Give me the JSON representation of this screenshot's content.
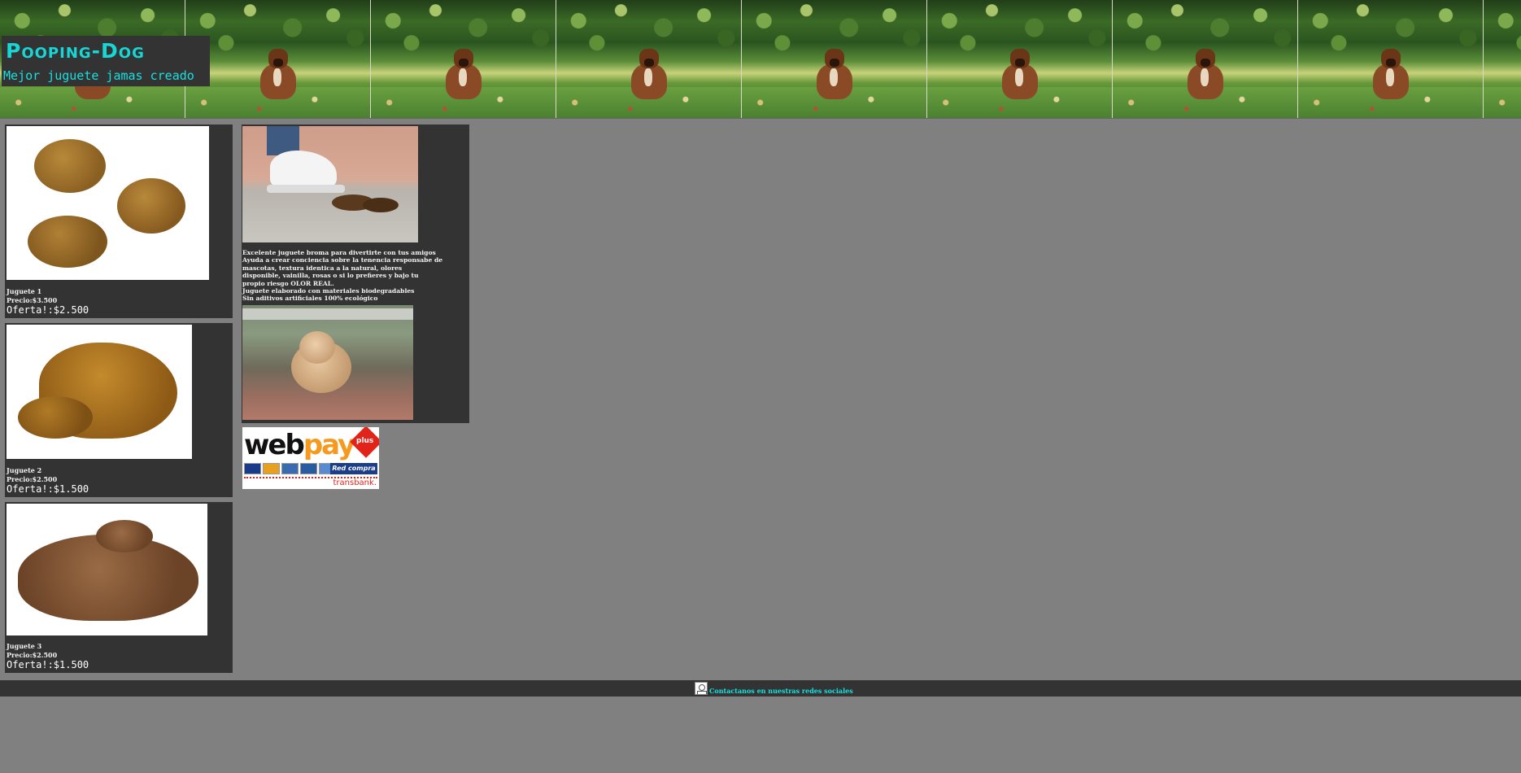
{
  "header": {
    "title": "Pooping-Dog",
    "subtitle": "Mejor juguete jamas creado"
  },
  "products": [
    {
      "name": "Juguete 1",
      "price": "Precio:$3.500",
      "offer": "Oferta!:$2.500"
    },
    {
      "name": "Juguete 2",
      "price": "Precio:$2.500",
      "offer": "Oferta!:$1.500"
    },
    {
      "name": "Juguete 3",
      "price": "Precio:$2.500",
      "offer": "Oferta!:$1.500"
    }
  ],
  "info": {
    "lines": [
      "Excelente juguete broma para divertirte con tus amigos",
      "Ayuda a crear conciencia sobre la tenencia responsabe de",
      "mascotas, textura identica a la natural, olores",
      "disponible, vainilla, rosas o si lo prefieres y bajo tu",
      "propio riesgo OLOR REAL.",
      "Juguete elaborado con materiales biodegradables",
      "Sin aditivos artificiales 100% ecológico"
    ]
  },
  "payment": {
    "web": "web",
    "pay": "pay",
    "plus": "plus",
    "red_compra": "Red compra",
    "transbank": "transbank."
  },
  "footer": {
    "contact_link": "Contactanos en nuestras redes sociales"
  },
  "colors": {
    "background": "#808080",
    "panel": "#333333",
    "accent_cyan": "#18d6d6"
  }
}
